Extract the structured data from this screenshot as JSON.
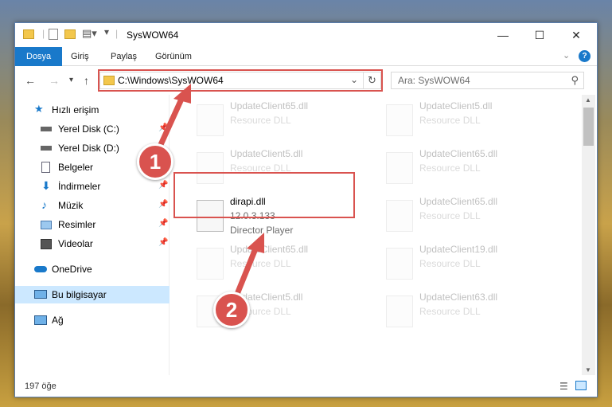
{
  "window": {
    "title": "SysWOW64"
  },
  "ribbon": {
    "tabs": [
      "Dosya",
      "Giriş",
      "Paylaş",
      "Görünüm"
    ]
  },
  "address": {
    "path": "C:\\Windows\\SysWOW64"
  },
  "search": {
    "placeholder": "Ara: SysWOW64"
  },
  "sidebar": {
    "items": [
      {
        "label": "Hızlı erişim",
        "icon": "star-icon",
        "pinned": false
      },
      {
        "label": "Yerel Disk (C:)",
        "icon": "drive-icon",
        "pinned": true
      },
      {
        "label": "Yerel Disk (D:)",
        "icon": "drive-icon",
        "pinned": false
      },
      {
        "label": "Belgeler",
        "icon": "document-icon",
        "pinned": true
      },
      {
        "label": "İndirmeler",
        "icon": "download-icon",
        "pinned": true
      },
      {
        "label": "Müzik",
        "icon": "music-icon",
        "pinned": true
      },
      {
        "label": "Resimler",
        "icon": "pictures-icon",
        "pinned": true
      },
      {
        "label": "Videolar",
        "icon": "video-icon",
        "pinned": true
      },
      {
        "label": "OneDrive",
        "icon": "cloud-icon",
        "pinned": false
      },
      {
        "label": "Bu bilgisayar",
        "icon": "computer-icon",
        "pinned": false
      },
      {
        "label": "Ağ",
        "icon": "network-icon",
        "pinned": false
      }
    ]
  },
  "files": [
    {
      "name": "UpdateClient65.dll",
      "type": "Resource DLL"
    },
    {
      "name": "UpdateClient5.dll",
      "type": "Resource DLL"
    },
    {
      "name": "UpdateClient5.dll",
      "type": "Resource DLL"
    },
    {
      "name": "UpdateClient65.dll",
      "type": "Resource DLL"
    },
    {
      "name": "dirapi.dll",
      "version": "12.0.3.133",
      "type": "Director Player"
    },
    {
      "name": "UpdateClient65.dll",
      "type": "Resource DLL"
    },
    {
      "name": "UpdateClient65.dll",
      "type": "Resource DLL"
    },
    {
      "name": "UpdateClient19.dll",
      "type": "Resource DLL"
    },
    {
      "name": "UpdateClient5.dll",
      "type": "Resource DLL"
    },
    {
      "name": "UpdateClient63.dll",
      "type": "Resource DLL"
    }
  ],
  "status": {
    "count": "197 öğe"
  },
  "annotations": {
    "step1": "1",
    "step2": "2",
    "color": "#d9534f"
  }
}
